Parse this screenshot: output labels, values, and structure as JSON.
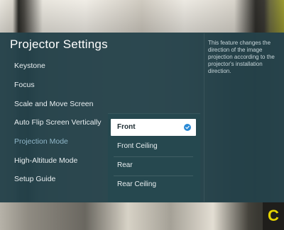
{
  "panel": {
    "title": "Projector Settings",
    "description": "This feature changes the direction of the image projection according to the projector's installation direction."
  },
  "menu": {
    "items": [
      {
        "label": "Keystone"
      },
      {
        "label": "Focus"
      },
      {
        "label": "Scale and Move Screen"
      },
      {
        "label": "Auto Flip Screen Vertically"
      },
      {
        "label": "Projection Mode",
        "active": true
      },
      {
        "label": "High-Altitude Mode"
      },
      {
        "label": "Setup Guide"
      }
    ]
  },
  "dropdown": {
    "selected": "Front",
    "options": [
      {
        "label": "Front"
      },
      {
        "label": "Front Ceiling"
      },
      {
        "label": "Rear"
      },
      {
        "label": "Rear Ceiling"
      }
    ]
  },
  "background": {
    "corner_text": "C"
  },
  "colors": {
    "overlay": "#24424a",
    "active_item": "#8fb6c8",
    "check_accent": "#2a8ad6"
  },
  "icons": {
    "selected_option": "checkmark-circle-icon"
  }
}
